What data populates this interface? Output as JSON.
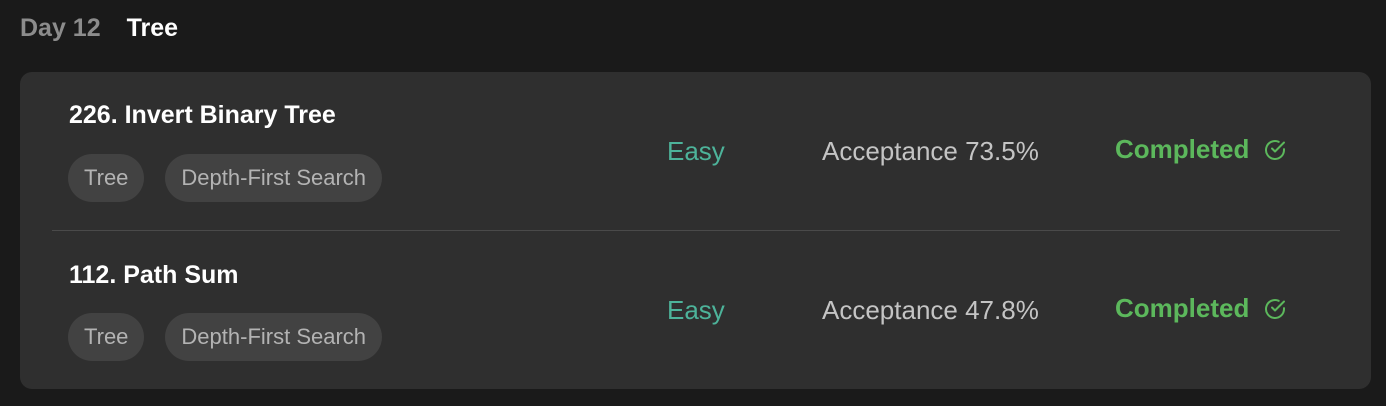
{
  "header": {
    "day": "Day 12",
    "topic": "Tree"
  },
  "problems": [
    {
      "title": "226. Invert Binary Tree",
      "tags": [
        "Tree",
        "Depth-First Search"
      ],
      "difficulty": "Easy",
      "acceptance": "Acceptance 73.5%",
      "status": "Completed",
      "status_icon": "check-circle-icon"
    },
    {
      "title": "112. Path Sum",
      "tags": [
        "Tree",
        "Depth-First Search"
      ],
      "difficulty": "Easy",
      "acceptance": "Acceptance 47.8%",
      "status": "Completed",
      "status_icon": "check-circle-icon"
    }
  ],
  "colors": {
    "background": "#1a1a1a",
    "card": "#2f2f2f",
    "tag_bg": "#424242",
    "easy": "#4db39a",
    "completed": "#5cb85c"
  }
}
